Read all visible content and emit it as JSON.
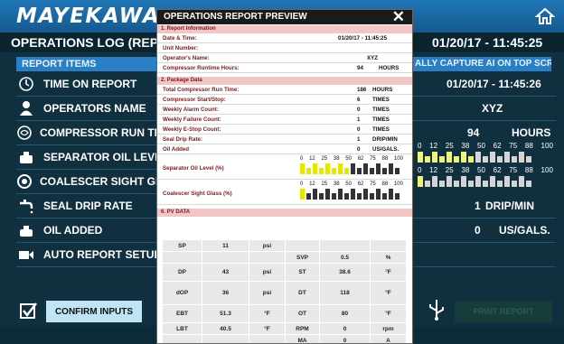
{
  "brand": {
    "logo_text": "MAYEKAWA"
  },
  "header": {
    "title": "OPERATIONS LOG (REPO",
    "datetime": "01/20/17 - 11:45:25"
  },
  "left": {
    "section_title": "REPORT ITEMS",
    "items": [
      {
        "label": "TIME ON REPORT"
      },
      {
        "label": "OPERATORS NAME"
      },
      {
        "label": "COMPRESSOR RUN TIME"
      },
      {
        "label": "SEPARATOR OIL LEVEL"
      },
      {
        "label": "COALESCER SIGHT GLASS"
      },
      {
        "label": "SEAL DRIP RATE"
      },
      {
        "label": "OIL ADDED"
      },
      {
        "label": "AUTO REPORT SETUP"
      }
    ],
    "confirm_label": "CONFIRM INPUTS"
  },
  "right": {
    "section_title": "ALLY CAPTURE AI ON TOP SCREEN",
    "time_value": "01/20/17 - 11:45:26",
    "operator_value": "XYZ",
    "run_time_value": "94",
    "run_time_unit": "HOURS",
    "scale_ticks": [
      "0",
      "12",
      "25",
      "38",
      "50",
      "62",
      "75",
      "88",
      "100"
    ],
    "separator_level_pct": 50,
    "coalescer_level_pct": 12,
    "seal_drip_value": "1",
    "seal_drip_unit": "DRIP/MIN",
    "oil_added_value": "0",
    "oil_added_unit": "US/GALS.",
    "print_label": "PRINT REPORT"
  },
  "modal": {
    "title": "OPERATIONS REPORT PREVIEW",
    "sec1_title": "1. Report Information",
    "date_label": "Date & Time:",
    "date_value": "01/20/17 - 11:45:25",
    "unit_label": "Unit Number:",
    "operator_label": "Operator's Name:",
    "operator_value": "XYZ",
    "runtime_label": "Compressor Runtime Hours:",
    "runtime_value": "94",
    "runtime_unit": "HOURS",
    "sec2_title": "2. Package Data",
    "pkg_rows": [
      {
        "label": "Total Compressor Run Time:",
        "value": "186",
        "unit": "HOURS"
      },
      {
        "label": "Compressor Start/Stop:",
        "value": "6",
        "unit": "TIMES"
      },
      {
        "label": "Weekly Alarm Count:",
        "value": "0",
        "unit": "TIMES"
      },
      {
        "label": "Weekly Failure Count:",
        "value": "1",
        "unit": "TIMES"
      },
      {
        "label": "Weekly E-Stop Count:",
        "value": "0",
        "unit": "TIMES"
      },
      {
        "label": "Seal Drip Rate:",
        "value": "1",
        "unit": "DRIP/MIN"
      },
      {
        "label": "Oil Added",
        "value": "0",
        "unit": "US/GALS."
      }
    ],
    "sep_label": "Separator Oil Level (%)",
    "coal_label": "Coalescer Sight Glass (%)",
    "sec6_title": "6. PV DATA",
    "pv": {
      "sp": [
        "SP",
        "11",
        "psi"
      ],
      "svp": [
        "SVP",
        "0.5",
        "%"
      ],
      "dp": [
        "DP",
        "43",
        "psi"
      ],
      "st": [
        "ST",
        "38.6",
        "°F"
      ],
      "dop": [
        "dOP",
        "36",
        "psi"
      ],
      "dt": [
        "DT",
        "118",
        "°F"
      ],
      "ebt": [
        "EBT",
        "51.3",
        "°F"
      ],
      "ot": [
        "OT",
        "80",
        "°F"
      ],
      "lbt": [
        "LBT",
        "40.5",
        "°F"
      ],
      "rpm": [
        "RPM",
        "0",
        "rpm"
      ],
      "ma": [
        "MA",
        "0",
        "A"
      ]
    }
  }
}
